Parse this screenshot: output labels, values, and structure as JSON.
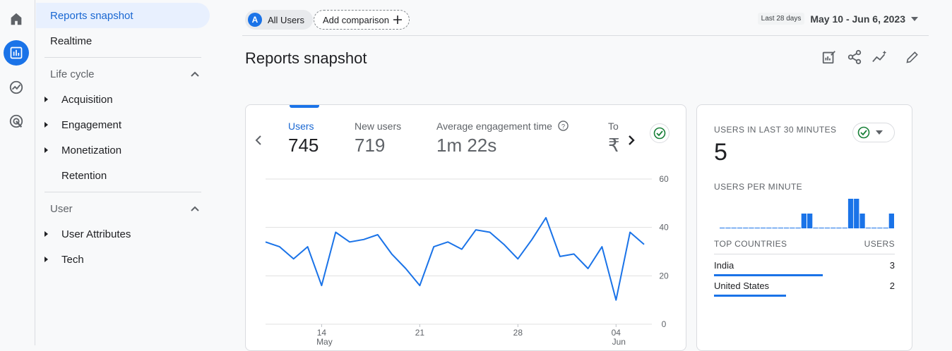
{
  "nav": {
    "active": "Reports snapshot",
    "realtime": "Realtime",
    "lifecycle": {
      "title": "Life cycle",
      "items": [
        "Acquisition",
        "Engagement",
        "Monetization",
        "Retention"
      ]
    },
    "user": {
      "title": "User",
      "items": [
        "User Attributes",
        "Tech"
      ]
    }
  },
  "header": {
    "segment_letter": "A",
    "segment_label": "All Users",
    "add_comparison": "Add comparison",
    "date_badge": "Last 28 days",
    "date_range": "May 10 - Jun 6, 2023",
    "title": "Reports snapshot"
  },
  "metrics": [
    {
      "label": "Users",
      "value": "745"
    },
    {
      "label": "New users",
      "value": "719"
    },
    {
      "label": "Average engagement time",
      "value": "1m 22s"
    },
    {
      "label": "To",
      "value": "₹"
    }
  ],
  "chart_data": {
    "type": "line",
    "title": "",
    "xlabel": "",
    "ylabel": "",
    "ylim": [
      0,
      60
    ],
    "yticks": [
      "60",
      "40",
      "20",
      "0"
    ],
    "xticks": [
      {
        "day": "14",
        "month": "May"
      },
      {
        "day": "21",
        "month": ""
      },
      {
        "day": "28",
        "month": ""
      },
      {
        "day": "04",
        "month": "Jun"
      }
    ],
    "series": [
      {
        "values": [
          34,
          32,
          27,
          32,
          16,
          38,
          34,
          35,
          37,
          29,
          23,
          16,
          32,
          34,
          31,
          39,
          38,
          33,
          27,
          35,
          44,
          28,
          29,
          23,
          32,
          10,
          38,
          33
        ]
      }
    ]
  },
  "realtime": {
    "title": "USERS IN LAST 30 MINUTES",
    "value": "5",
    "per_minute_title": "USERS PER MINUTE",
    "per_minute": [
      0,
      0,
      0,
      0,
      0,
      0,
      0,
      0,
      0,
      0,
      0,
      0,
      0,
      0,
      1,
      1,
      0,
      0,
      0,
      0,
      0,
      0,
      2,
      2,
      1,
      0,
      0,
      0,
      0,
      1
    ],
    "countries_header": "TOP COUNTRIES",
    "users_header": "USERS",
    "countries": [
      {
        "name": "India",
        "value": "3",
        "share": 0.6
      },
      {
        "name": "United States",
        "value": "2",
        "share": 0.4
      }
    ]
  },
  "colors": {
    "accent": "#1a73e8",
    "success": "#188038"
  }
}
